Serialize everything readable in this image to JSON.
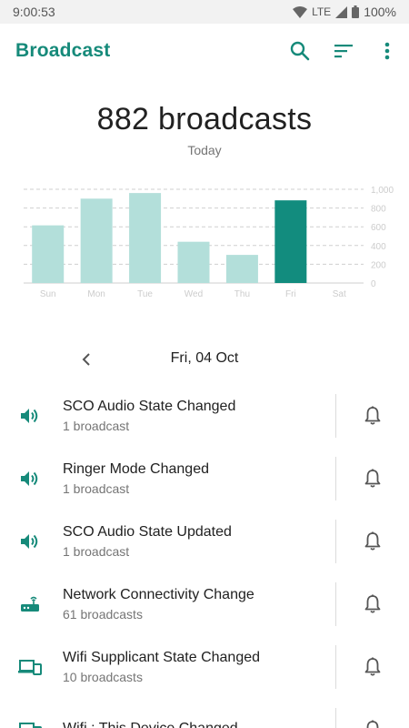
{
  "status_bar": {
    "time": "9:00:53",
    "network": "LTE",
    "battery": "100%"
  },
  "app_bar": {
    "title": "Broadcast",
    "icons": [
      "search-icon",
      "filter-icon",
      "more-vert-icon"
    ],
    "accent_color": "#168a7a"
  },
  "summary": {
    "count": "882 broadcasts",
    "period": "Today"
  },
  "chart_data": {
    "type": "bar",
    "categories": [
      "Sun",
      "Mon",
      "Tue",
      "Wed",
      "Thu",
      "Fri",
      "Sat"
    ],
    "values": [
      615,
      900,
      960,
      440,
      300,
      882,
      0
    ],
    "highlight_index": 5,
    "ylim": [
      0,
      1000
    ],
    "yticks": [
      "1,000",
      "800",
      "600",
      "400",
      "200",
      "0"
    ],
    "ytick_values": [
      1000,
      800,
      600,
      400,
      200,
      0
    ],
    "grid": true,
    "colors": {
      "bar": "#b3dfda",
      "highlight": "#128c7e",
      "grid": "#cfcfcf",
      "tick": "#cccccc"
    }
  },
  "date_nav": {
    "label": "Fri, 04 Oct"
  },
  "list": {
    "items": [
      {
        "title": "SCO Audio State Changed",
        "subtitle": "1 broadcast",
        "icon": "volume-icon"
      },
      {
        "title": "Ringer Mode Changed",
        "subtitle": "1 broadcast",
        "icon": "volume-icon"
      },
      {
        "title": "SCO Audio State Updated",
        "subtitle": "1 broadcast",
        "icon": "volume-icon"
      },
      {
        "title": "Network Connectivity Change",
        "subtitle": "61 broadcasts",
        "icon": "router-icon"
      },
      {
        "title": "Wifi Supplicant State Changed",
        "subtitle": "10 broadcasts",
        "icon": "devices-icon"
      },
      {
        "title": "Wifi : This Device Changed",
        "subtitle": "",
        "icon": "devices-icon"
      }
    ]
  }
}
